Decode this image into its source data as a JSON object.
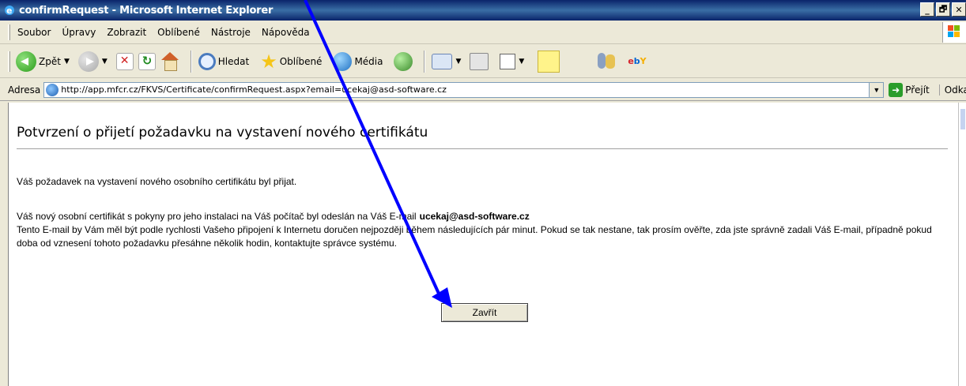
{
  "window": {
    "title": "confirmRequest - Microsoft Internet Explorer",
    "controls": [
      "_",
      "🗗",
      "✕"
    ]
  },
  "menu": {
    "items": [
      "Soubor",
      "Úpravy",
      "Zobrazit",
      "Oblíbené",
      "Nástroje",
      "Nápověda"
    ]
  },
  "toolbar": {
    "back_label": "Zpět",
    "search_label": "Hledat",
    "favorites_label": "Oblíbené",
    "media_label": "Média",
    "icons": [
      "back-icon",
      "forward-icon",
      "stop-icon",
      "refresh-icon",
      "home-icon",
      "search-icon",
      "favorites-star-icon",
      "media-icon",
      "history-icon",
      "mail-icon",
      "print-icon",
      "edit-icon",
      "note-icon",
      "messenger-icon",
      "ebay-icon"
    ]
  },
  "address": {
    "label": "Adresa",
    "url": "http://app.mfcr.cz/FKVS/Certificate/confirmRequest.aspx?email=ucekaj@asd-software.cz",
    "go_label": "Přejít",
    "links_label": "Odkazy"
  },
  "page": {
    "title": "Potvrzení o přijetí požadavku na vystavení nového certifikátu",
    "para1": "Váš požadavek na vystavení nového osobního certifikátu byl přijat.",
    "para2_prefix": "Váš nový osobní certifikát s pokyny pro jeho instalaci na Váš počítač byl odeslán na Váš E-mail",
    "email": "ucekaj@asd-software.cz",
    "para2_rest": "Tento E-mail by Vám měl být podle rychlosti Vašeho připojení k Internetu doručen nejpozději během následujících pár minut. Pokud se tak nestane, tak prosím ověřte, zda jste správně zadali Váš E-mail, případně pokud doba od vznesení tohoto požadavku přesáhne několik hodin, kontaktujte správce systému.",
    "close_button": "Zavřít"
  },
  "colors": {
    "titlebar": "#0a246a",
    "chrome": "#ece9d8",
    "annotation_arrow": "#0000ff"
  }
}
